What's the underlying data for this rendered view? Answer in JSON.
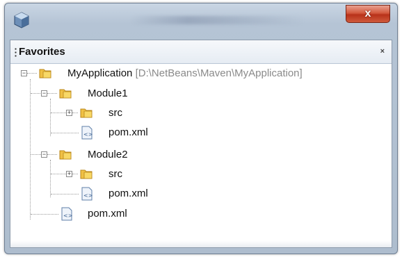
{
  "window": {
    "close_label": "x"
  },
  "panel": {
    "title": "Favorites",
    "close_label": "×"
  },
  "tree": {
    "root_label": "MyApplication",
    "root_path": "[D:\\NetBeans\\Maven\\MyApplication]",
    "module1": {
      "label": "Module1",
      "src": "src",
      "pom": "pom.xml"
    },
    "module2": {
      "label": "Module2",
      "src": "src",
      "pom": "pom.xml"
    },
    "root_pom": "pom.xml"
  },
  "icons": {
    "app": "app-cube-icon",
    "folder": "folder-icon",
    "xml": "xml-file-icon"
  }
}
